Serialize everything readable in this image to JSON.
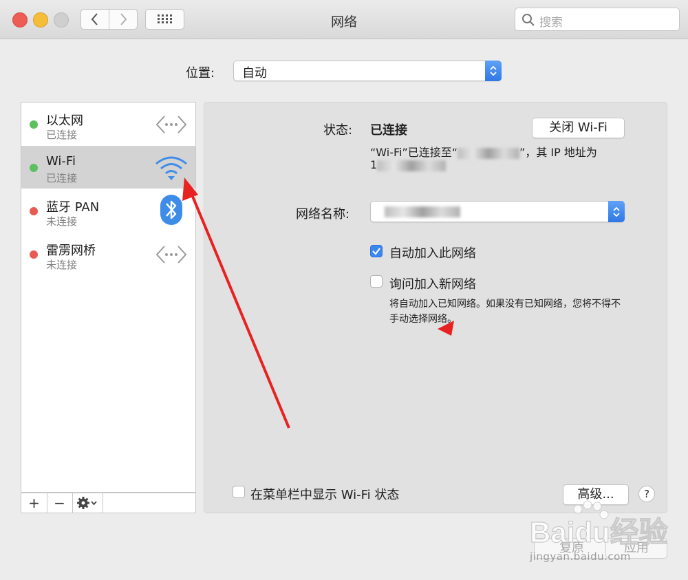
{
  "window": {
    "title": "网络"
  },
  "search": {
    "placeholder": "搜索"
  },
  "location": {
    "label": "位置:",
    "value": "自动"
  },
  "services": [
    {
      "name": "以太网",
      "status": "已连接",
      "dot_color": "#5ac15e",
      "icon": "ethernet-icon"
    },
    {
      "name": "Wi-Fi",
      "status": "已连接",
      "dot_color": "#5ac15e",
      "icon": "wifi-icon"
    },
    {
      "name": "蓝牙 PAN",
      "status": "未连接",
      "dot_color": "#e85b54",
      "icon": "bluetooth-icon"
    },
    {
      "name": "雷雳网桥",
      "status": "未连接",
      "dot_color": "#e85b54",
      "icon": "thunderbolt-bridge-icon"
    }
  ],
  "toolbar": {
    "add": "+",
    "remove": "−"
  },
  "detail": {
    "status_label": "状态:",
    "status_value": "已连接",
    "toggle_button": "关闭 Wi-Fi",
    "status_desc_1": "“Wi-Fi”已连接至“",
    "status_desc_2": "”，其 IP 地址为",
    "status_desc_ip_prefix": "1",
    "network_name_label": "网络名称:",
    "auto_join_label": "自动加入此网络",
    "ask_join_label": "询问加入新网络",
    "ask_join_desc": "将自动加入已知网络。如果没有已知网络，您将不得不手动选择网络。",
    "show_menu_label": "在菜单栏中显示 Wi-Fi 状态",
    "advanced_button": "高级...",
    "help_button": "?"
  },
  "footer": {
    "revert": "复原",
    "apply": "应用"
  },
  "watermark": {
    "brand": "Baidu经验",
    "url": "jingyan.baidu.com"
  },
  "accent_color": "#3b86ef",
  "annotation_color": "#e82121"
}
